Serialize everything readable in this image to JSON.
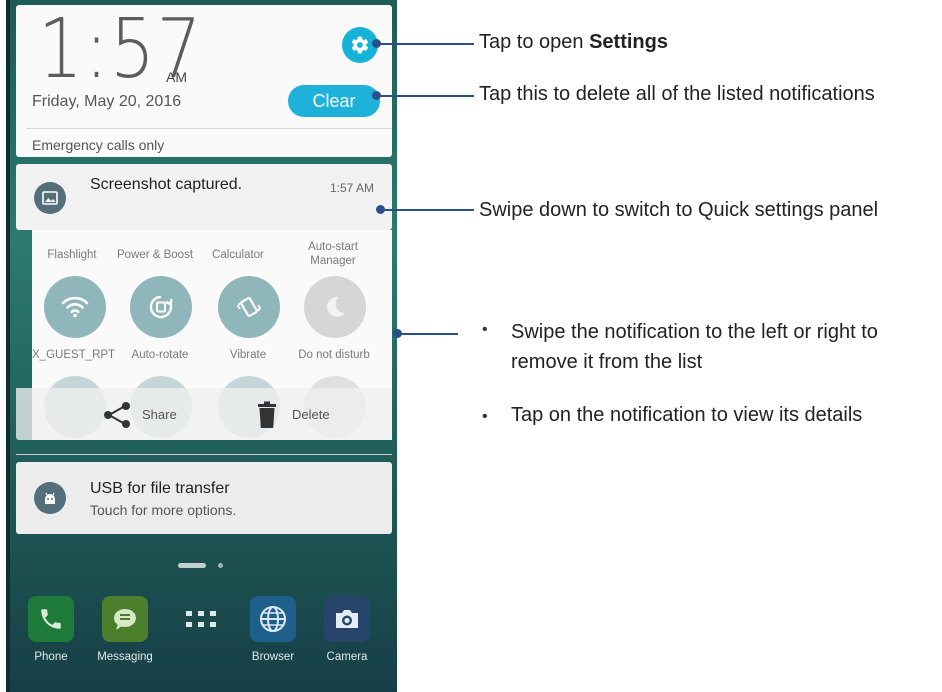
{
  "lockscreen": {
    "time": "1:57",
    "ampm": "AM",
    "date": "Friday, May 20, 2016",
    "clear_label": "Clear",
    "status": "Emergency calls only"
  },
  "notification": {
    "title": "Screenshot captured.",
    "time": "1:57 AM",
    "icon": "image-icon"
  },
  "quick_settings": {
    "row1_labels": [
      "Flashlight",
      "Power & Boost",
      "Calculator",
      "Auto-start Manager"
    ],
    "row2_labels": [
      "X_GUEST_RPT",
      "Auto-rotate",
      "Vibrate",
      "Do not disturb"
    ],
    "row2_icons": [
      "wifi-icon",
      "auto-rotate-icon",
      "vibrate-icon",
      "moon-icon"
    ],
    "row2_active": [
      true,
      true,
      true,
      false
    ]
  },
  "actions": {
    "share_label": "Share",
    "delete_label": "Delete"
  },
  "usb_notification": {
    "title": "USB for file transfer",
    "subtitle": "Touch for more options.",
    "icon": "android-icon"
  },
  "dock": [
    {
      "label": "Phone",
      "icon": "phone-icon",
      "color": "#1e7a3a"
    },
    {
      "label": "Messaging",
      "icon": "messaging-icon",
      "color": "#4b7f2b"
    },
    {
      "label": "",
      "icon": "apps-grid-icon",
      "color": ""
    },
    {
      "label": "Browser",
      "icon": "globe-icon",
      "color": "#1f5f8c"
    },
    {
      "label": "Camera",
      "icon": "camera-icon",
      "color": "#27456b"
    }
  ],
  "callouts": {
    "settings_prefix": "Tap to open ",
    "settings_bold": "Settings",
    "clear": "Tap this to delete all of the listed notifications",
    "swipe_down": "Swipe down to switch to Quick settings panel",
    "swipe_side": "Swipe the notification to the left or right to remove it from the list",
    "swipe_side_line1": "Swipe the notification to the left or right to",
    "swipe_side_line2": "remove it from the list",
    "tap_details": "Tap on the notification to view its details"
  },
  "colors": {
    "accent": "#1eb1d9",
    "callout_line": "#2b4f8c"
  }
}
